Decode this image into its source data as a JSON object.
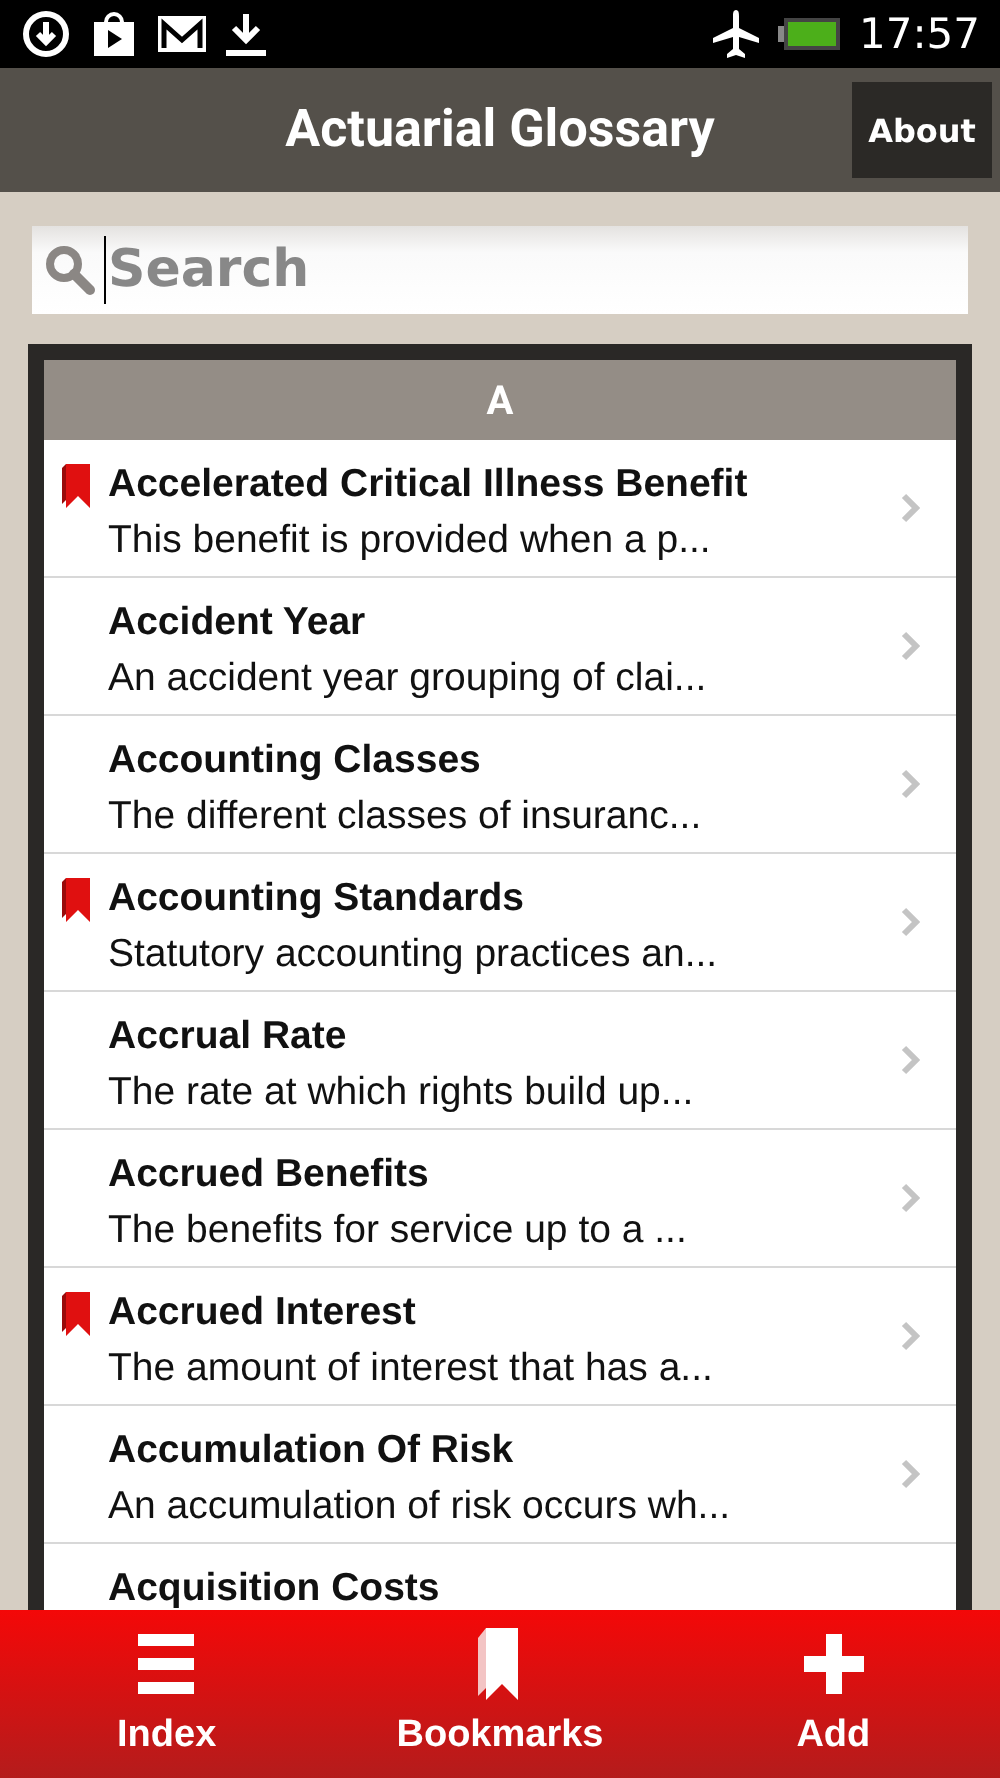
{
  "status_bar": {
    "time": "17:57"
  },
  "title_bar": {
    "title": "Actuarial Glossary",
    "action": "About"
  },
  "search": {
    "placeholder": "Search"
  },
  "section": {
    "header": "A"
  },
  "terms": [
    {
      "title": "Accelerated Critical Illness Benefit",
      "description": "This benefit is provided when a p...",
      "bookmarked": true
    },
    {
      "title": "Accident Year",
      "description": "An accident year grouping of clai...",
      "bookmarked": false
    },
    {
      "title": "Accounting Classes",
      "description": "The different classes of insuranc...",
      "bookmarked": false
    },
    {
      "title": "Accounting Standards",
      "description": "Statutory accounting practices an...",
      "bookmarked": true
    },
    {
      "title": "Accrual Rate",
      "description": "The rate at which rights build up...",
      "bookmarked": false
    },
    {
      "title": "Accrued Benefits",
      "description": "The benefits for service up to a ...",
      "bookmarked": false
    },
    {
      "title": "Accrued Interest",
      "description": "The amount of interest that has a...",
      "bookmarked": true
    },
    {
      "title": "Accumulation Of Risk",
      "description": "An accumulation of risk occurs wh...",
      "bookmarked": false
    },
    {
      "title": "Acquisition Costs",
      "bookmarked": false
    }
  ],
  "tabs": [
    {
      "kind": "index",
      "label": "Index"
    },
    {
      "kind": "bookmarks",
      "label": "Bookmarks"
    },
    {
      "kind": "add",
      "label": "Add"
    }
  ]
}
